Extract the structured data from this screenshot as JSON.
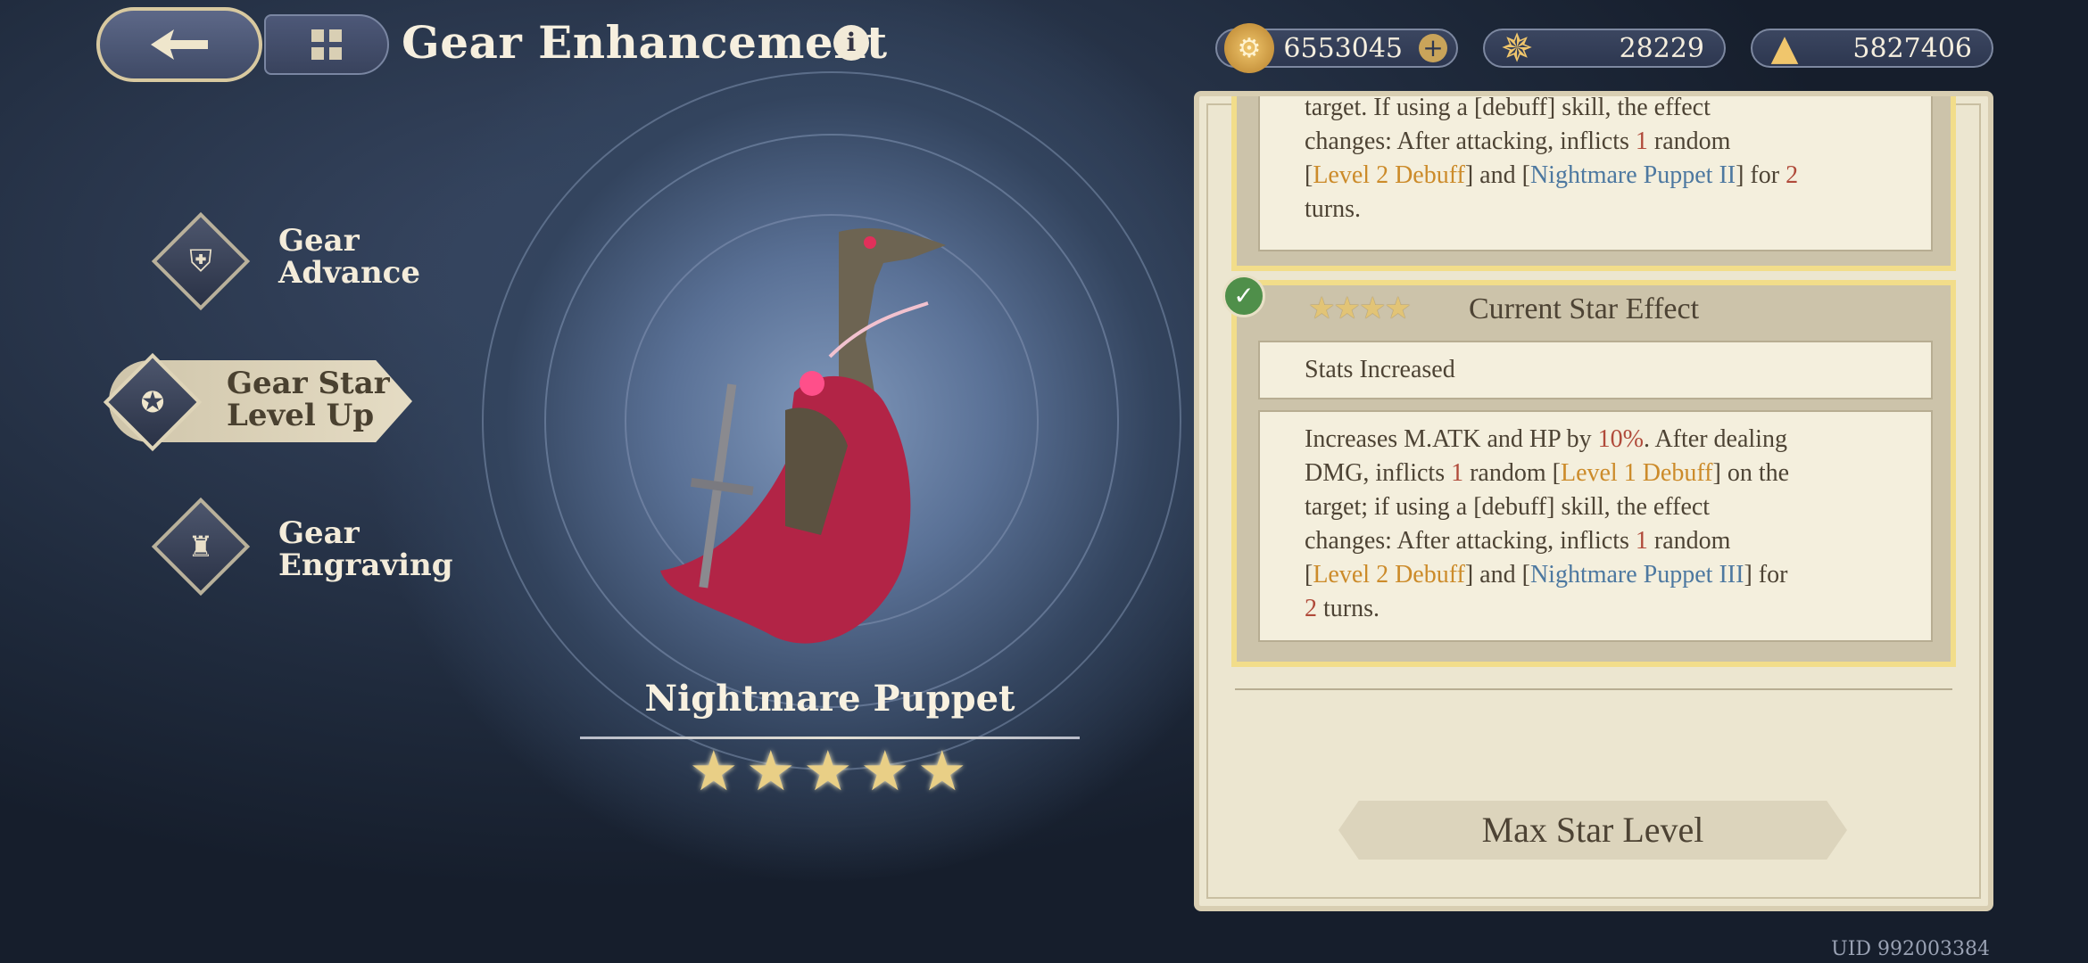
{
  "header": {
    "title": "Gear Enhancement",
    "info_icon": "i"
  },
  "currencies": [
    {
      "icon": "gold-coin-icon",
      "value": "6553045",
      "has_add": true
    },
    {
      "icon": "crystal-orb-icon",
      "value": "28229"
    },
    {
      "icon": "star-shard-icon",
      "value": "5827406"
    }
  ],
  "side_menu": [
    {
      "label_line1": "Gear",
      "label_line2": "Advance",
      "active": false
    },
    {
      "label_line1": "Gear Star",
      "label_line2": "Level Up",
      "active": true
    },
    {
      "label_line1": "Gear",
      "label_line2": "Engraving",
      "active": false
    }
  ],
  "item": {
    "name": "Nightmare Puppet",
    "stars": 5
  },
  "panel": {
    "prev_effect": {
      "line1": "target. If using a [debuff] skill, the effect",
      "line2_a": "changes: After attacking, inflicts ",
      "line2_num": "1",
      "line2_b": " random",
      "line3_open": "[",
      "line3_debuff": "Level 2 Debuff",
      "line3_mid": "] and [",
      "line3_puppet": "Nightmare Puppet II",
      "line3_end": "] for ",
      "line3_num": "2",
      "line4": "turns."
    },
    "current": {
      "title": "Current Star Effect",
      "stars": "★★★★",
      "stats_label": "Stats Increased",
      "desc": {
        "a": "Increases M.ATK and HP by ",
        "pct": "10%",
        "b": ". After dealing",
        "c": "DMG, inflicts ",
        "n1": "1",
        "d": " random [",
        "debuff1": "Level 1 Debuff",
        "e": "] on the",
        "f": "target; if using a [debuff] skill, the effect",
        "g": "changes: After attacking, inflicts ",
        "n2": "1",
        "h": " random",
        "i": "[",
        "debuff2": "Level 2 Debuff",
        "j": "] and [",
        "puppet": "Nightmare Puppet III",
        "k": "] for",
        "n3": "2",
        "l": " turns."
      }
    },
    "max_button": "Max Star Level"
  },
  "uid": "UID 992003384"
}
